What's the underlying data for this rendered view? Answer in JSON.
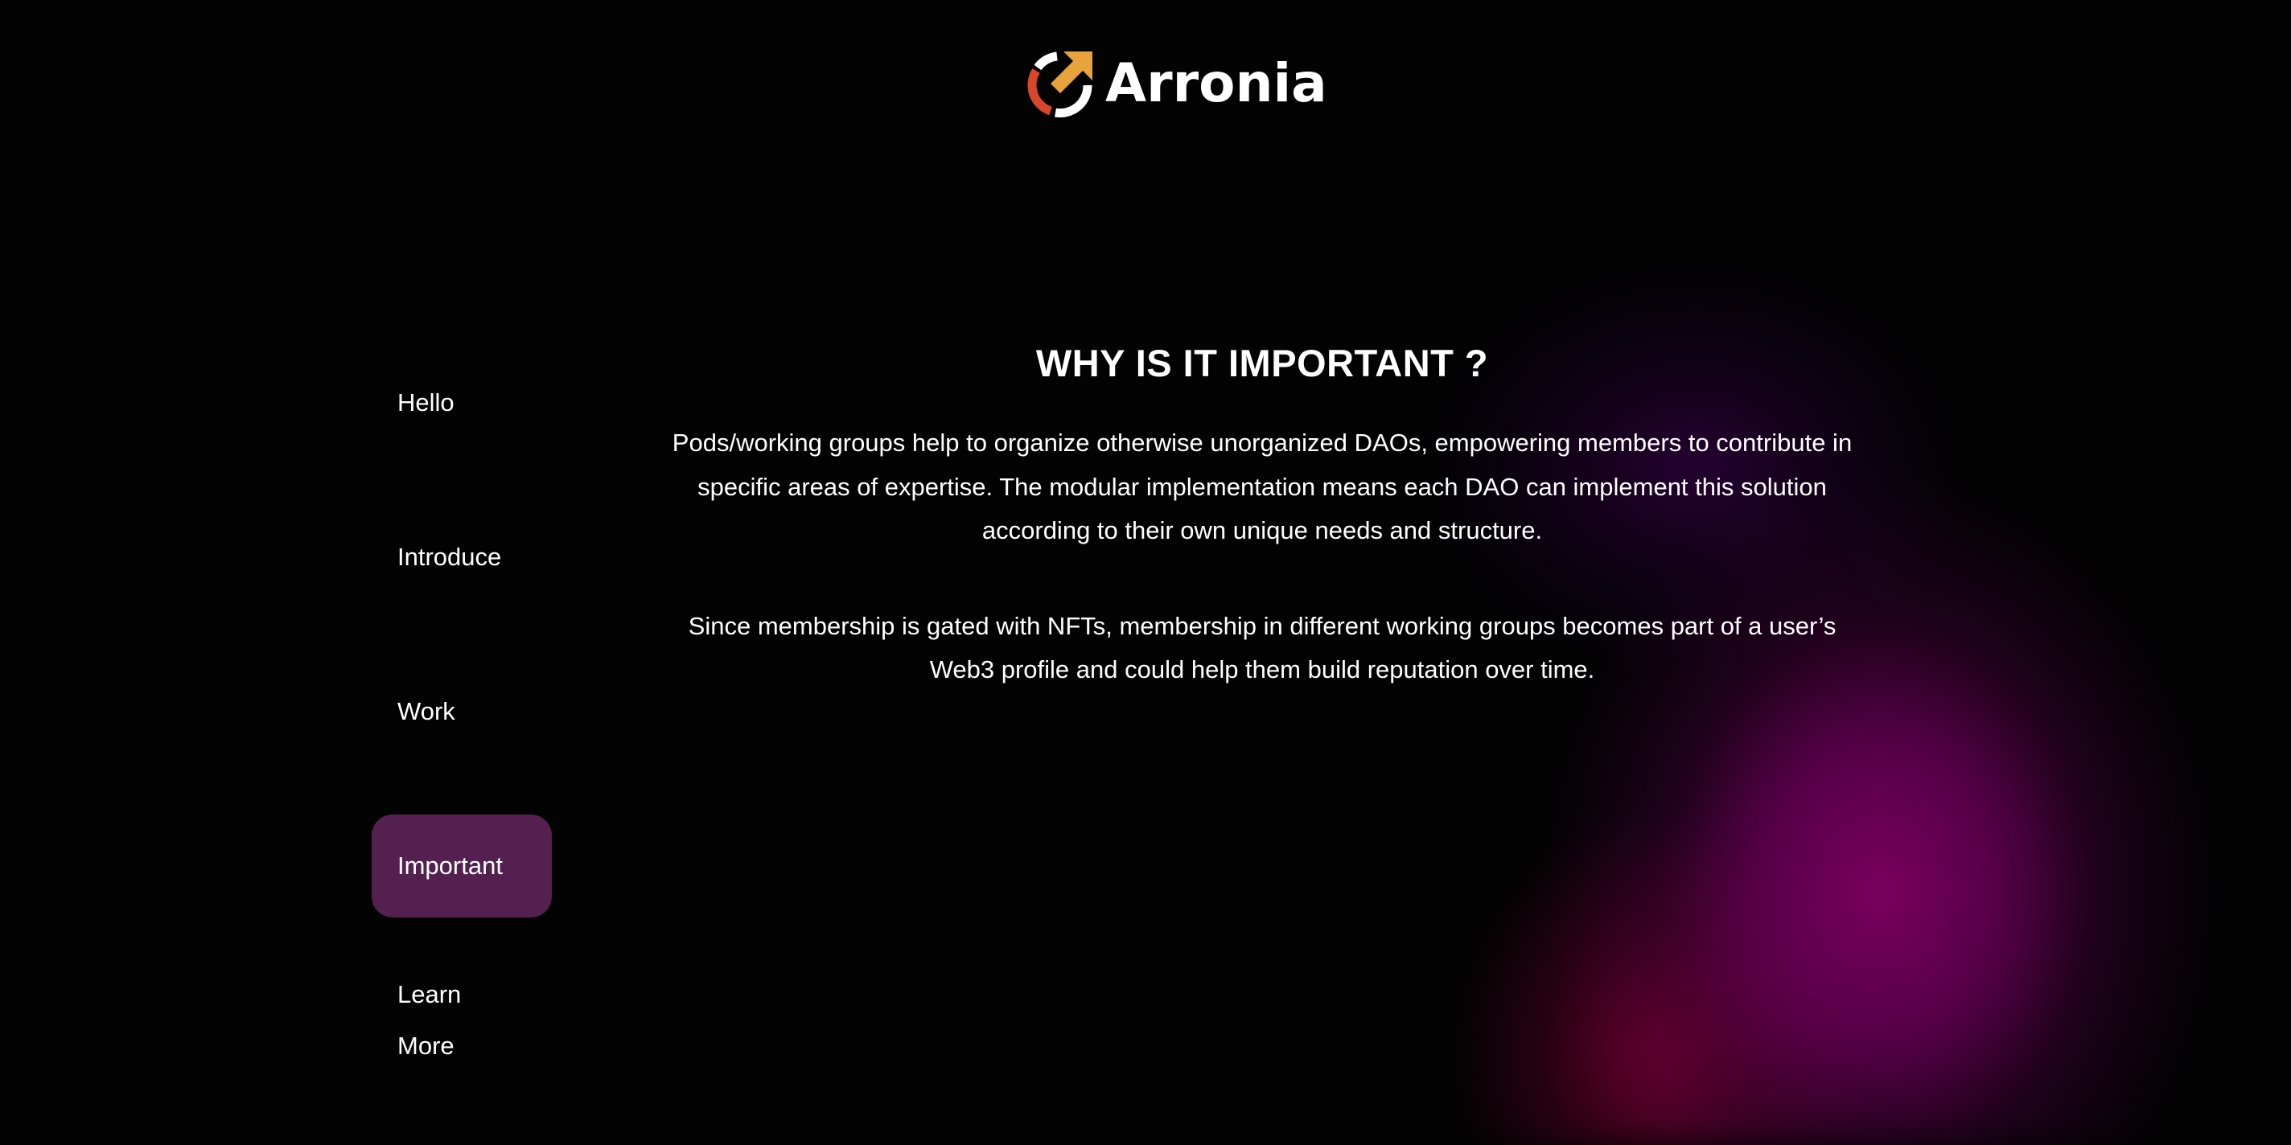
{
  "brand": {
    "name": "Arronia",
    "logo_icon": "circular-arrow-icon",
    "colors": {
      "orange": "#e8a33c",
      "red": "#d9472b",
      "white": "#ffffff"
    }
  },
  "sidebar": {
    "items": [
      {
        "label": "Hello",
        "active": false
      },
      {
        "label": "Introduce",
        "active": false
      },
      {
        "label": "Work",
        "active": false
      },
      {
        "label": "Important",
        "active": true
      },
      {
        "label_line1": "Learn",
        "label_line2": "More",
        "active": false
      }
    ],
    "active_color": "#53204f"
  },
  "main": {
    "title": "WHY IS IT IMPORTANT ?",
    "paragraph1_lines": [
      "Pods/working groups help to organize otherwise unorganized DAOs, empowering members to contribute in",
      "specific areas of expertise. The modular implementation means each DAO can implement this solution",
      "according to their own unique needs and structure."
    ],
    "paragraph2_lines": [
      "Since membership is gated with NFTs, membership in different working groups becomes part of a user’s",
      "Web3 profile and could help them build reputation over time."
    ]
  },
  "background": {
    "base_color": "#030303",
    "glow_color": "#800064"
  }
}
